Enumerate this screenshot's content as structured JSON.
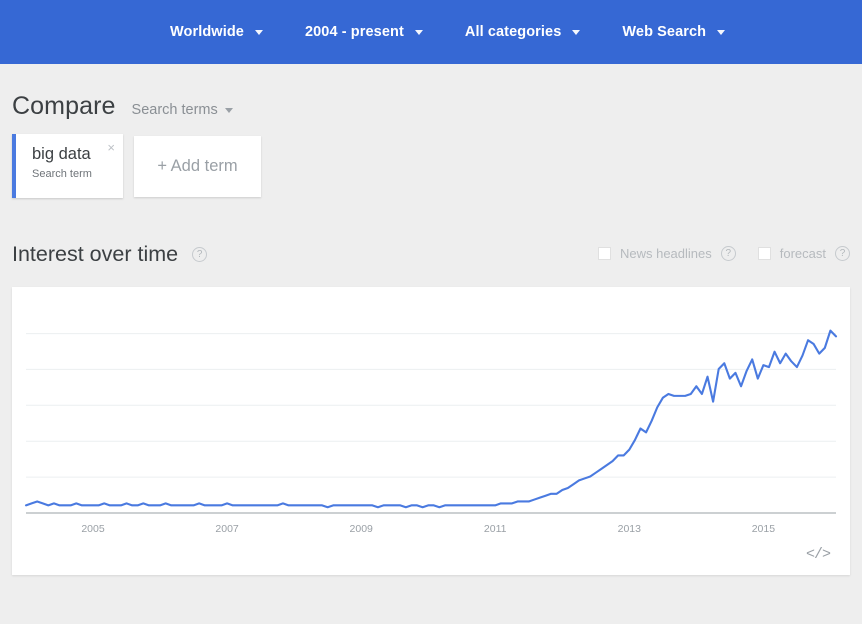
{
  "topbar": {
    "background": "#3668d4",
    "filters": [
      {
        "label": "Worldwide",
        "icon": "chevron-down-icon"
      },
      {
        "label": "2004 - present",
        "icon": "chevron-down-icon"
      },
      {
        "label": "All categories",
        "icon": "chevron-down-icon"
      },
      {
        "label": "Web Search",
        "icon": "chevron-down-icon"
      }
    ]
  },
  "compare": {
    "title": "Compare",
    "type_selector": "Search terms",
    "terms": [
      {
        "name": "big data",
        "subtitle": "Search term",
        "close": "×",
        "accent": "#4a7ae0"
      }
    ],
    "add_label": "+ Add term"
  },
  "interest": {
    "title": "Interest over time",
    "help": "?",
    "options": [
      {
        "label": "News headlines",
        "checked": false,
        "help": "?"
      },
      {
        "label": "forecast",
        "checked": false,
        "help": "?"
      }
    ],
    "embed_icon": "</>"
  },
  "chart_data": {
    "type": "line",
    "title": "Interest over time",
    "xlabel": "",
    "ylabel": "",
    "series_name": "big data",
    "line_color": "#4a7ae0",
    "grid": true,
    "gridlines": 5,
    "legend_position": "none",
    "xlim": [
      "2004-01",
      "2016-02"
    ],
    "ylim": [
      0,
      100
    ],
    "xtick_labels": [
      "2005",
      "2007",
      "2009",
      "2011",
      "2013",
      "2015"
    ],
    "xtick_values": [
      2005,
      2007,
      2009,
      2011,
      2013,
      2015
    ],
    "x": [
      "2004-01",
      "2004-02",
      "2004-03",
      "2004-04",
      "2004-05",
      "2004-06",
      "2004-07",
      "2004-08",
      "2004-09",
      "2004-10",
      "2004-11",
      "2004-12",
      "2005-01",
      "2005-02",
      "2005-03",
      "2005-04",
      "2005-05",
      "2005-06",
      "2005-07",
      "2005-08",
      "2005-09",
      "2005-10",
      "2005-11",
      "2005-12",
      "2006-01",
      "2006-02",
      "2006-03",
      "2006-04",
      "2006-05",
      "2006-06",
      "2006-07",
      "2006-08",
      "2006-09",
      "2006-10",
      "2006-11",
      "2006-12",
      "2007-01",
      "2007-02",
      "2007-03",
      "2007-04",
      "2007-05",
      "2007-06",
      "2007-07",
      "2007-08",
      "2007-09",
      "2007-10",
      "2007-11",
      "2007-12",
      "2008-01",
      "2008-02",
      "2008-03",
      "2008-04",
      "2008-05",
      "2008-06",
      "2008-07",
      "2008-08",
      "2008-09",
      "2008-10",
      "2008-11",
      "2008-12",
      "2009-01",
      "2009-02",
      "2009-03",
      "2009-04",
      "2009-05",
      "2009-06",
      "2009-07",
      "2009-08",
      "2009-09",
      "2009-10",
      "2009-11",
      "2009-12",
      "2010-01",
      "2010-02",
      "2010-03",
      "2010-04",
      "2010-05",
      "2010-06",
      "2010-07",
      "2010-08",
      "2010-09",
      "2010-10",
      "2010-11",
      "2010-12",
      "2011-01",
      "2011-02",
      "2011-03",
      "2011-04",
      "2011-05",
      "2011-06",
      "2011-07",
      "2011-08",
      "2011-09",
      "2011-10",
      "2011-11",
      "2011-12",
      "2012-01",
      "2012-02",
      "2012-03",
      "2012-04",
      "2012-05",
      "2012-06",
      "2012-07",
      "2012-08",
      "2012-09",
      "2012-10",
      "2012-11",
      "2012-12",
      "2013-01",
      "2013-02",
      "2013-03",
      "2013-04",
      "2013-05",
      "2013-06",
      "2013-07",
      "2013-08",
      "2013-09",
      "2013-10",
      "2013-11",
      "2013-12",
      "2014-01",
      "2014-02",
      "2014-03",
      "2014-04",
      "2014-05",
      "2014-06",
      "2014-07",
      "2014-08",
      "2014-09",
      "2014-10",
      "2014-11",
      "2014-12",
      "2015-01",
      "2015-02",
      "2015-03",
      "2015-04",
      "2015-05",
      "2015-06",
      "2015-07",
      "2015-08",
      "2015-09",
      "2015-10",
      "2015-11",
      "2015-12",
      "2016-01",
      "2016-02"
    ],
    "values": [
      4,
      5,
      6,
      5,
      4,
      5,
      4,
      4,
      4,
      5,
      4,
      4,
      4,
      4,
      5,
      4,
      4,
      4,
      5,
      4,
      4,
      5,
      4,
      4,
      4,
      5,
      4,
      4,
      4,
      4,
      4,
      5,
      4,
      4,
      4,
      4,
      5,
      4,
      4,
      4,
      4,
      4,
      4,
      4,
      4,
      4,
      5,
      4,
      4,
      4,
      4,
      4,
      4,
      4,
      3,
      4,
      4,
      4,
      4,
      4,
      4,
      4,
      4,
      3,
      4,
      4,
      4,
      4,
      3,
      4,
      4,
      3,
      4,
      4,
      3,
      4,
      4,
      4,
      4,
      4,
      4,
      4,
      4,
      4,
      4,
      5,
      5,
      5,
      6,
      6,
      6,
      7,
      8,
      9,
      10,
      10,
      12,
      13,
      15,
      17,
      18,
      19,
      21,
      23,
      25,
      27,
      30,
      30,
      33,
      38,
      44,
      42,
      48,
      55,
      60,
      62,
      61,
      61,
      61,
      62,
      66,
      62,
      71,
      58,
      75,
      78,
      70,
      73,
      66,
      74,
      80,
      70,
      77,
      76,
      84,
      78,
      83,
      79,
      76,
      82,
      90,
      88,
      83,
      86,
      95,
      92
    ]
  }
}
